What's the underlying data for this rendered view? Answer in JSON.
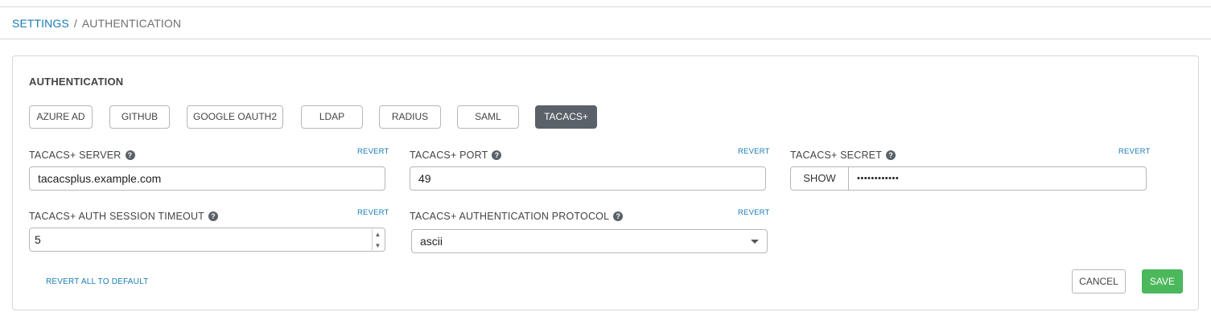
{
  "breadcrumb": {
    "parent": "SETTINGS",
    "separator": "/",
    "current": "AUTHENTICATION"
  },
  "panel": {
    "title": "AUTHENTICATION",
    "tabs": [
      {
        "label": "AZURE AD"
      },
      {
        "label": "GITHUB"
      },
      {
        "label": "GOOGLE OAUTH2"
      },
      {
        "label": "LDAP"
      },
      {
        "label": "RADIUS"
      },
      {
        "label": "SAML"
      },
      {
        "label": "TACACS+",
        "active": true
      }
    ],
    "revert_label": "REVERT",
    "fields": {
      "server": {
        "label": "TACACS+ SERVER",
        "value": "tacacsplus.example.com"
      },
      "port": {
        "label": "TACACS+ PORT",
        "value": "49"
      },
      "secret": {
        "label": "TACACS+ SECRET",
        "show_label": "SHOW",
        "masked_value": "••••••••••••"
      },
      "timeout": {
        "label": "TACACS+ AUTH SESSION TIMEOUT",
        "value": "5"
      },
      "protocol": {
        "label": "TACACS+ AUTHENTICATION PROTOCOL",
        "selected": "ascii"
      }
    },
    "revert_all_label": "REVERT ALL TO DEFAULT",
    "cancel_label": "CANCEL",
    "save_label": "SAVE",
    "help_glyph": "?"
  },
  "colors": {
    "link": "#1a7bb5",
    "active_tab": "#5a6169",
    "save": "#4cb85c"
  }
}
